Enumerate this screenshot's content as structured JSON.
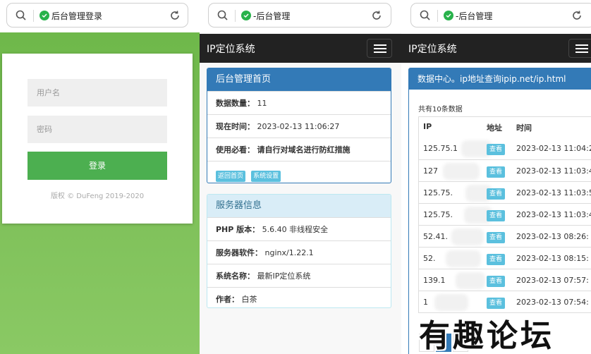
{
  "login_page": {
    "address_title": "后台管理登录",
    "username_placeholder": "用户名",
    "password_placeholder": "密码",
    "login_label": "登录",
    "copyright": "版权 © DuFeng 2019-2020"
  },
  "admin_page": {
    "address_title": "-后台管理",
    "brand": "IP定位系统",
    "home_panel": {
      "title": "后台管理首页",
      "rows": [
        {
          "label": "数据数量：",
          "value": "11"
        },
        {
          "label": "现在时间：",
          "value": "2023-02-13 11:06:27"
        },
        {
          "label": "使用必看：",
          "value": "请自行对域名进行防红措施"
        }
      ],
      "buttons": [
        "返回首页",
        "系统设置"
      ]
    },
    "server_panel": {
      "title": "服务器信息",
      "rows": [
        {
          "label": "PHP 版本：",
          "value": "5.6.40 非线程安全"
        },
        {
          "label": "服务器软件：",
          "value": "nginx/1.22.1"
        },
        {
          "label": "系统名称：",
          "value": "最新IP定位系统"
        },
        {
          "label": "作者：",
          "value": "白茶"
        }
      ]
    }
  },
  "data_page": {
    "address_title": "-后台管理",
    "brand": "IP定位系统",
    "panel_title": "数据中心。ip地址查询ipip.net/ip.html",
    "count_text": "共有10条数据",
    "columns": [
      "IP",
      "地址",
      "时间"
    ],
    "rows": [
      {
        "ip": "125.75.1",
        "action": "查看",
        "time": "2023-02-13 11:04:2"
      },
      {
        "ip": "127",
        "action": "查看",
        "time": "2023-02-13 11:03:4"
      },
      {
        "ip": "125.75.",
        "action": "查看",
        "time": "2023-02-13 11:03:5"
      },
      {
        "ip": "125.75.",
        "action": "查看",
        "time": "2023-02-13 11:03:4"
      },
      {
        "ip": "52.41.",
        "action": "查看",
        "time": "2023-02-13 08:26:"
      },
      {
        "ip": "52.",
        "action": "查看",
        "time": "2023-02-13 08:15:"
      },
      {
        "ip": "139.1",
        "action": "查看",
        "time": "2023-02-13 07:57:"
      },
      {
        "ip": "1",
        "action": "查看",
        "time": "2023-02-13 07:54:"
      }
    ],
    "pager": {
      "prev": "«",
      "current": "1",
      "next": "»"
    }
  },
  "watermark": "有趣论坛",
  "colors": {
    "login_green": "#4caf50",
    "primary_blue": "#337ab7",
    "info_btn": "#5bc0de",
    "navbar": "#222222",
    "secure_green": "#28b24b"
  }
}
